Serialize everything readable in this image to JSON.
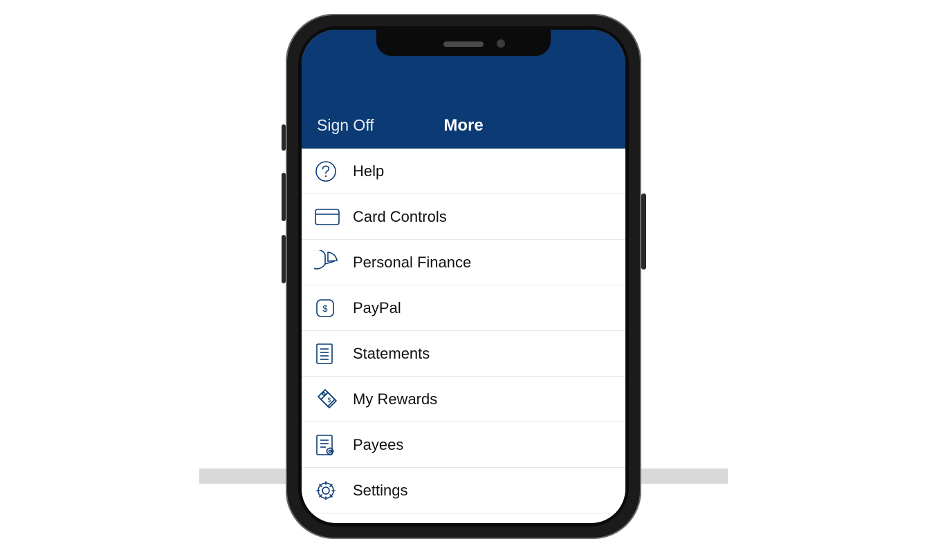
{
  "header": {
    "signoff_label": "Sign Off",
    "title": "More"
  },
  "menu": {
    "items": [
      {
        "icon": "help-icon",
        "label": "Help"
      },
      {
        "icon": "card-icon",
        "label": "Card Controls"
      },
      {
        "icon": "pie-chart-icon",
        "label": "Personal Finance"
      },
      {
        "icon": "paypal-icon",
        "label": "PayPal"
      },
      {
        "icon": "document-icon",
        "label": "Statements"
      },
      {
        "icon": "tag-icon",
        "label": "My Rewards"
      },
      {
        "icon": "list-gear-icon",
        "label": "Payees"
      },
      {
        "icon": "gear-icon",
        "label": "Settings"
      }
    ]
  },
  "colors": {
    "header_bg": "#0b3a74",
    "icon_stroke": "#0b3a74"
  }
}
